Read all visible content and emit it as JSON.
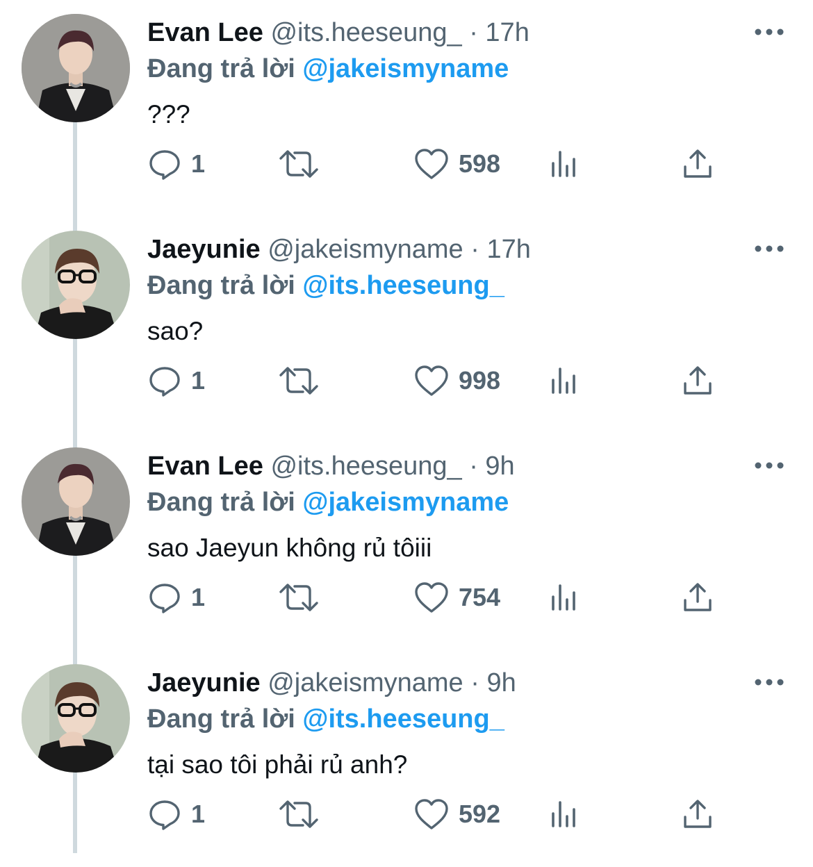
{
  "tweets": [
    {
      "display_name": "Evan Lee",
      "handle": "@its.heeseung_",
      "separator": "·",
      "time": "17h",
      "reply_prefix": "Đang trả lời",
      "reply_to": "@jakeismyname",
      "text": "???",
      "reply_count": "1",
      "like_count": "598",
      "avatar": "avatar-evan"
    },
    {
      "display_name": "Jaeyunie",
      "handle": "@jakeismyname",
      "separator": "·",
      "time": "17h",
      "reply_prefix": "Đang trả lời",
      "reply_to": "@its.heeseung_",
      "text": "sao?",
      "reply_count": "1",
      "like_count": "998",
      "avatar": "avatar-jaeyun"
    },
    {
      "display_name": "Evan Lee",
      "handle": "@its.heeseung_",
      "separator": "·",
      "time": "9h",
      "reply_prefix": "Đang trả lời",
      "reply_to": "@jakeismyname",
      "text": "sao Jaeyun không rủ tôiii",
      "reply_count": "1",
      "like_count": "754",
      "avatar": "avatar-evan"
    },
    {
      "display_name": "Jaeyunie",
      "handle": "@jakeismyname",
      "separator": "·",
      "time": "9h",
      "reply_prefix": "Đang trả lời",
      "reply_to": "@its.heeseung_",
      "text": "tại sao tôi phải rủ anh?",
      "reply_count": "1",
      "like_count": "592",
      "avatar": "avatar-jaeyun"
    }
  ],
  "colors": {
    "text_primary": "#0f1419",
    "text_secondary": "#536471",
    "accent": "#1d9bf0",
    "thread_line": "#cfd9de"
  },
  "icons": [
    "comment-icon",
    "retweet-icon",
    "heart-icon",
    "views-icon",
    "share-icon",
    "more-icon"
  ]
}
